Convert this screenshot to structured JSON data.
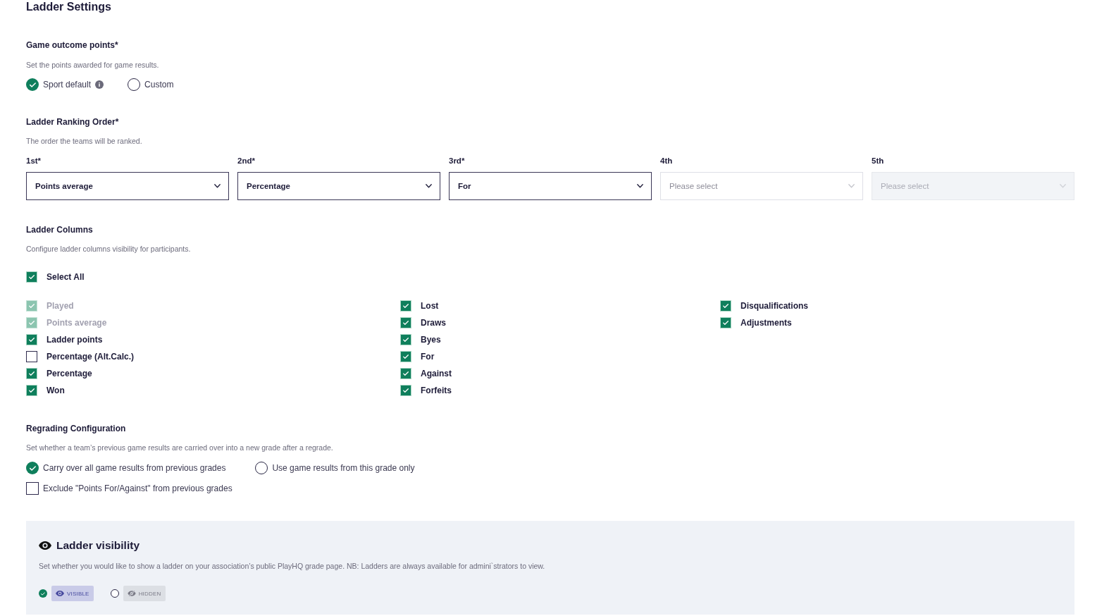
{
  "page": {
    "title": "Ladder Settings"
  },
  "game_outcome_points": {
    "title": "Game outcome points*",
    "description": "Set the points awarded for game results.",
    "options": [
      {
        "label": "Sport default",
        "selected": true,
        "info": true
      },
      {
        "label": "Custom",
        "selected": false,
        "info": false
      }
    ]
  },
  "ladder_ranking_order": {
    "title": "Ladder Ranking Order*",
    "description": "The order the teams will be ranked.",
    "selects": [
      {
        "label": "1st*",
        "value": "Points average",
        "disabled": false
      },
      {
        "label": "2nd*",
        "value": "Percentage",
        "disabled": false
      },
      {
        "label": "3rd*",
        "value": "For",
        "disabled": false
      },
      {
        "label": "4th",
        "placeholder": "Please select",
        "disabled": false
      },
      {
        "label": "5th",
        "placeholder": "Please select",
        "disabled": true
      }
    ]
  },
  "ladder_columns": {
    "title": "Ladder Columns",
    "description": "Configure ladder columns visibility for participants.",
    "select_all": {
      "label": "Select All",
      "checked": true
    },
    "columns": [
      {
        "items": [
          {
            "label": "Played",
            "checked": true,
            "disabled": true
          },
          {
            "label": "Points average",
            "checked": true,
            "disabled": true
          },
          {
            "label": "Ladder points",
            "checked": true,
            "disabled": false
          },
          {
            "label": "Percentage (Alt.Calc.)",
            "checked": false,
            "disabled": false
          },
          {
            "label": "Percentage",
            "checked": true,
            "disabled": false
          },
          {
            "label": "Won",
            "checked": true,
            "disabled": false
          }
        ]
      },
      {
        "items": [
          {
            "label": "Lost",
            "checked": true,
            "disabled": false
          },
          {
            "label": "Draws",
            "checked": true,
            "disabled": false
          },
          {
            "label": "Byes",
            "checked": true,
            "disabled": false
          },
          {
            "label": "For",
            "checked": true,
            "disabled": false
          },
          {
            "label": "Against",
            "checked": true,
            "disabled": false
          },
          {
            "label": "Forfeits",
            "checked": true,
            "disabled": false
          }
        ]
      },
      {
        "items": [
          {
            "label": "Disqualifications",
            "checked": true,
            "disabled": false
          },
          {
            "label": "Adjustments",
            "checked": true,
            "disabled": false
          }
        ]
      }
    ]
  },
  "regrading_configuration": {
    "title": "Regrading Configuration",
    "description": "Set whether a team’s previous game results are carried over into a new grade after a regrade.",
    "options": [
      {
        "label": "Carry over all game results from previous grades",
        "selected": true
      },
      {
        "label": "Use game results from this grade only",
        "selected": false
      }
    ],
    "exclude": {
      "label": "Exclude \"Points For/Against\" from previous grades",
      "checked": false
    }
  },
  "ladder_visibility": {
    "title": "Ladder visibility",
    "description": "Set whether you would like to show a ladder on your association’s public PlayHQ grade page. NB: Ladders are always available for admini`strators to view.",
    "options": [
      {
        "label": "VISIBLE",
        "kind": "visible",
        "selected": true
      },
      {
        "label": "HIDDEN",
        "kind": "hidden",
        "selected": false
      }
    ]
  }
}
